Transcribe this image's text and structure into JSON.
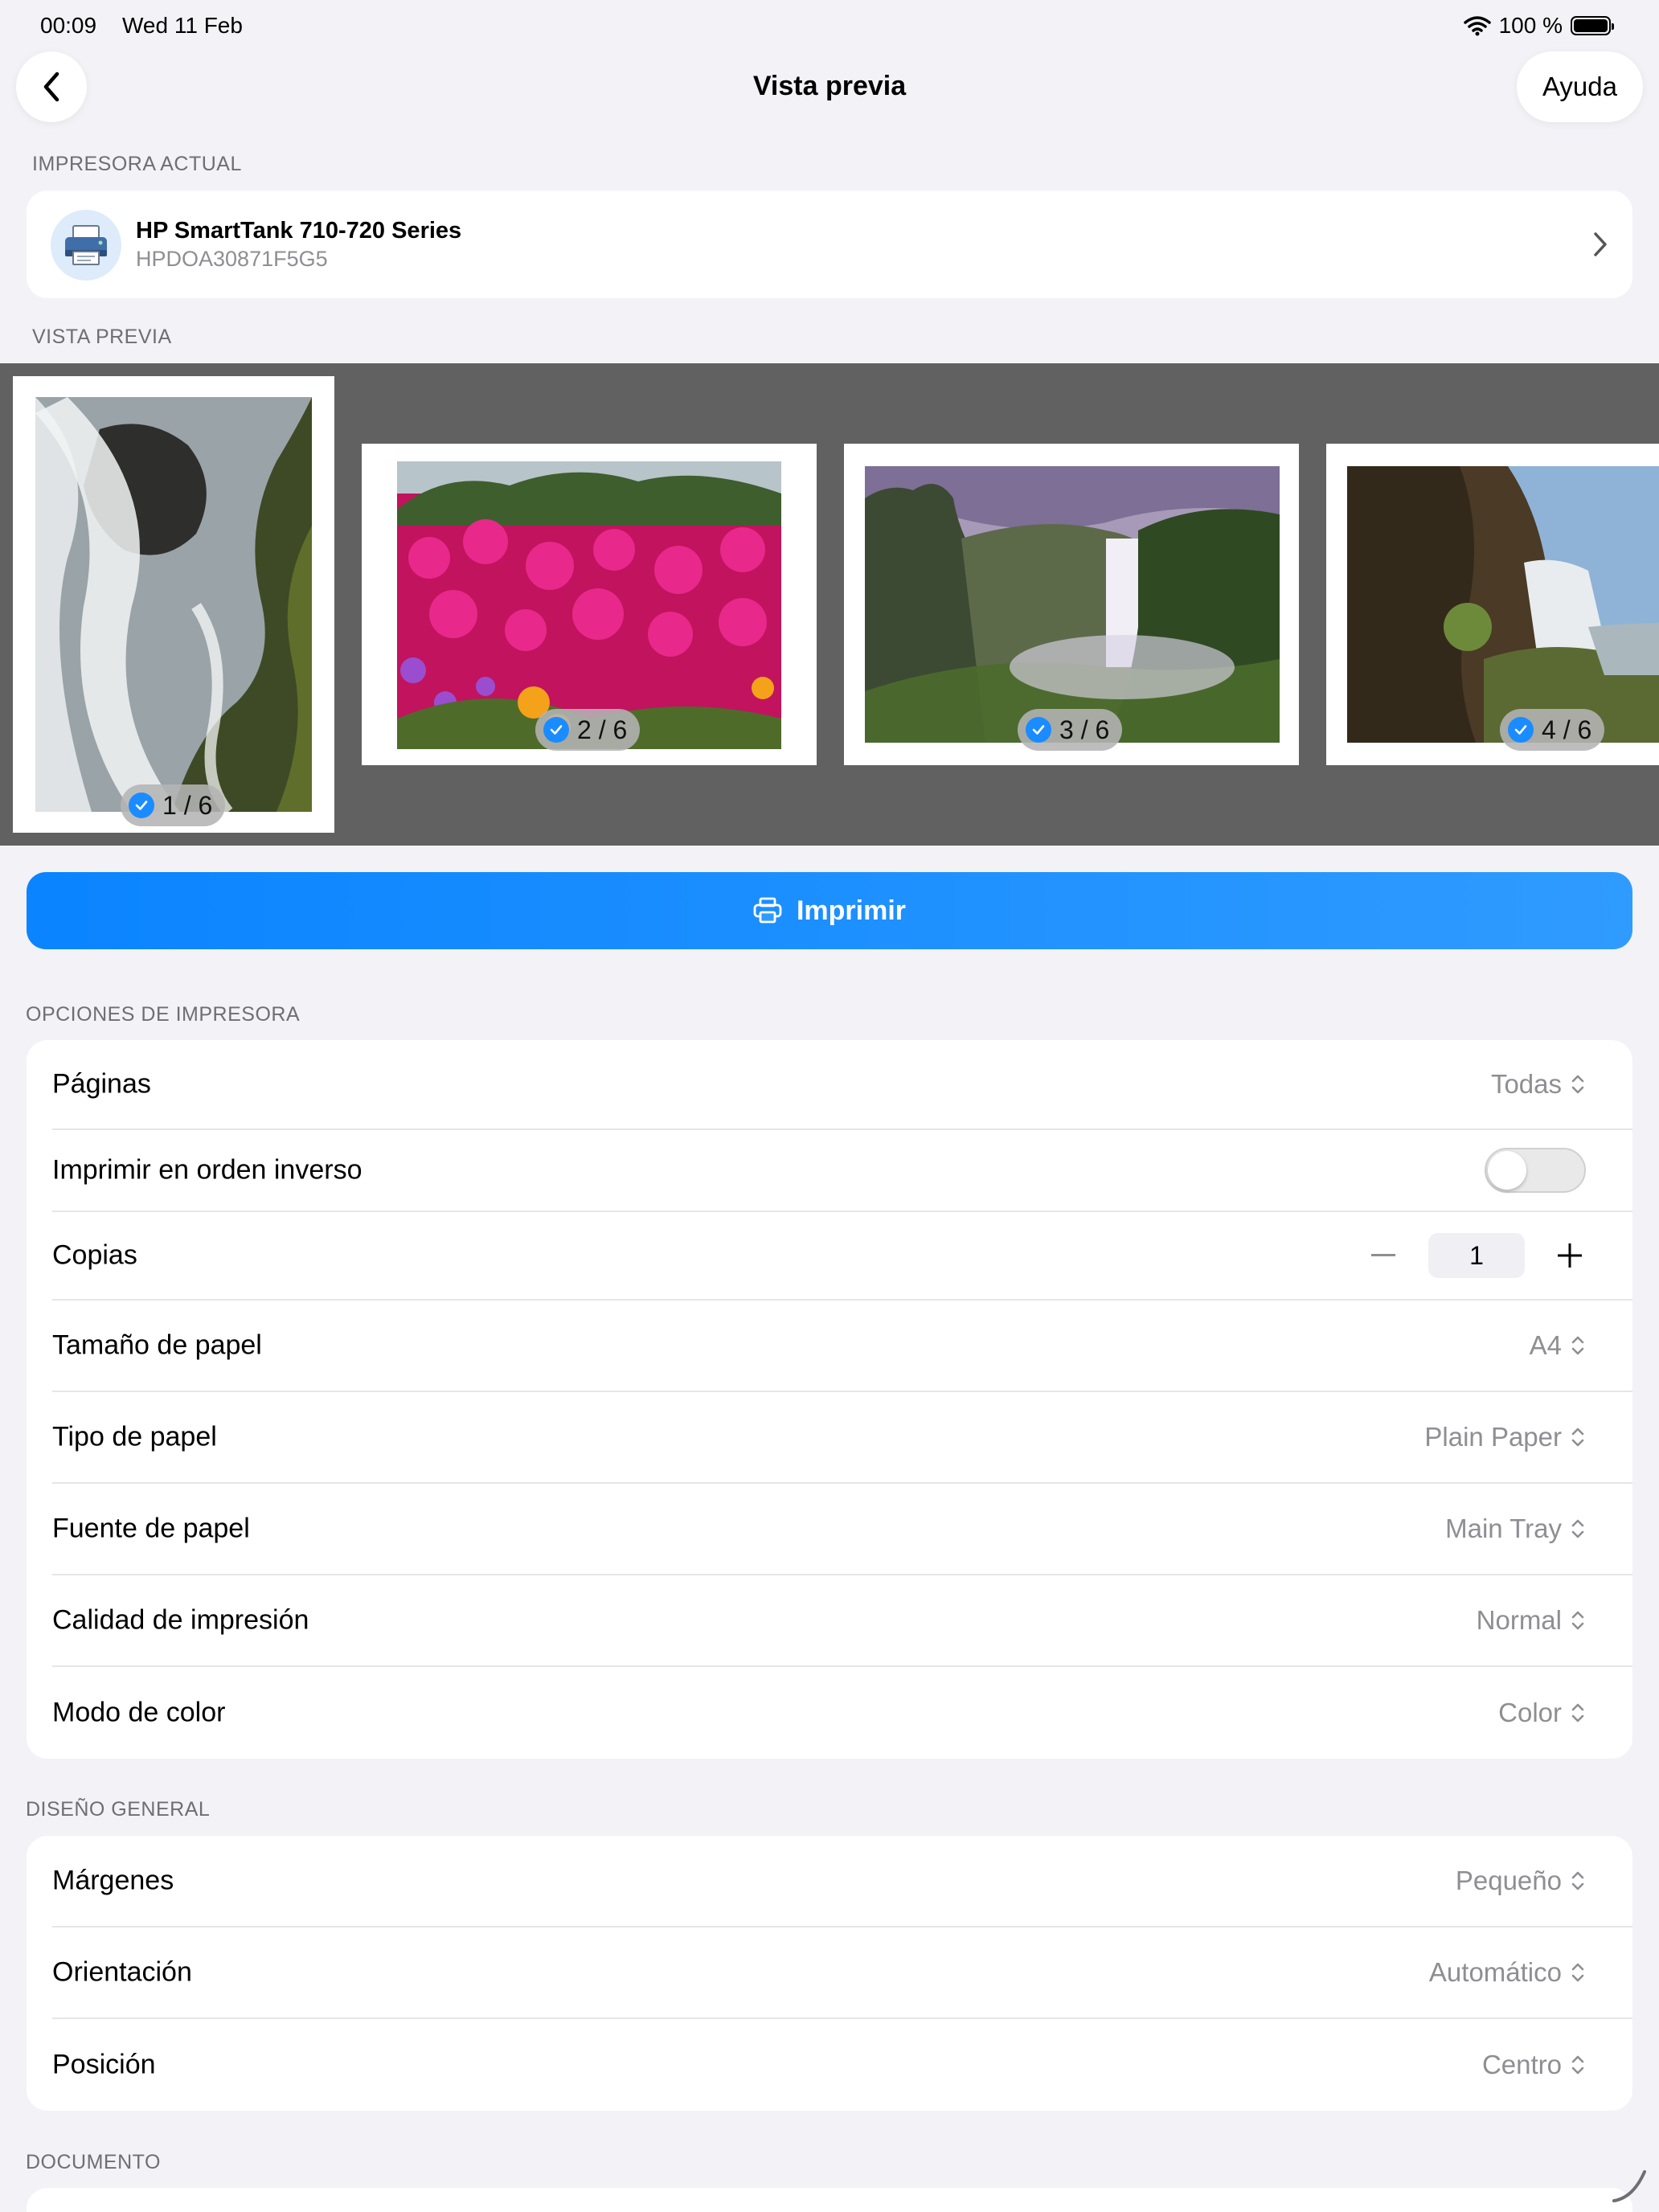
{
  "status_bar": {
    "time": "00:09",
    "date": "Wed 11 Feb",
    "battery_percent": "100 %",
    "battery_level": 1.0
  },
  "nav": {
    "back_icon": "chevron-left-icon",
    "title": "Vista previa",
    "help_label": "Ayuda"
  },
  "printer_section": {
    "header": "IMPRESORA ACTUAL",
    "printer_name": "HP SmartTank 710-720 Series",
    "printer_id": "HPDOA30871F5G5",
    "icon": "printer-icon"
  },
  "preview_section": {
    "header": "VISTA PREVIA",
    "thumbnails": [
      {
        "badge": "1 / 6",
        "subject": "waterfall-closeup",
        "selected": true
      },
      {
        "badge": "2 / 6",
        "subject": "pink-flowers",
        "selected": true
      },
      {
        "badge": "3 / 6",
        "subject": "waterfall-valley",
        "selected": true
      },
      {
        "badge": "4 / 6",
        "subject": "cliff-waterfall",
        "selected": true
      }
    ]
  },
  "print_button": {
    "label": "Imprimir",
    "icon": "printer-icon",
    "color": "#0a84ff"
  },
  "printer_options": {
    "header": "OPCIONES DE IMPRESORA",
    "pages": {
      "label": "Páginas",
      "value": "Todas"
    },
    "reverse_order": {
      "label": "Imprimir en orden inverso",
      "on": false
    },
    "copies": {
      "label": "Copias",
      "value": "1"
    },
    "paper_size": {
      "label": "Tamaño de papel",
      "value": "A4"
    },
    "paper_type": {
      "label": "Tipo de papel",
      "value": "Plain Paper"
    },
    "paper_source": {
      "label": "Fuente de papel",
      "value": "Main Tray"
    },
    "quality": {
      "label": "Calidad de impresión",
      "value": "Normal"
    },
    "color_mode": {
      "label": "Modo de color",
      "value": "Color"
    }
  },
  "layout_options": {
    "header": "DISEÑO GENERAL",
    "margins": {
      "label": "Márgenes",
      "value": "Pequeño"
    },
    "orientation": {
      "label": "Orientación",
      "value": "Automático"
    },
    "position": {
      "label": "Posición",
      "value": "Centro"
    }
  },
  "document_section": {
    "header": "DOCUMENTO"
  }
}
